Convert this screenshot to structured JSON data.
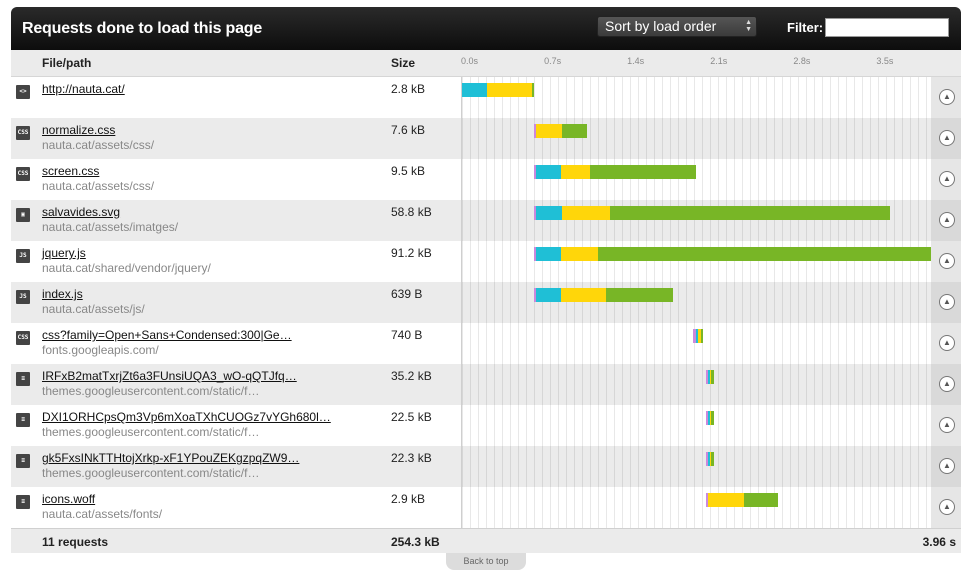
{
  "header": {
    "title": "Requests done to load this page",
    "sort_label": "Sort by load order",
    "filter_label": "Filter:",
    "filter_value": ""
  },
  "columns": {
    "file": "File/path",
    "size": "Size",
    "ticks": [
      "0.0s",
      "0.7s",
      "1.4s",
      "2.1s",
      "2.8s",
      "3.5s"
    ]
  },
  "timeline_total_seconds": 3.96,
  "requests": [
    {
      "name": "http://nauta.cat/",
      "path": "",
      "size": "2.8 kB",
      "type": "html",
      "phases": [
        {
          "k": "dns",
          "s": 0.0,
          "d": 0.21
        },
        {
          "k": "wait",
          "s": 0.21,
          "d": 0.38
        },
        {
          "k": "recv",
          "s": 0.59,
          "d": 0.02
        }
      ]
    },
    {
      "name": "normalize.css",
      "path": "nauta.cat/assets/css/",
      "size": "7.6 kB",
      "type": "css",
      "phases": [
        {
          "k": "blocked",
          "s": 0.61,
          "d": 0.01
        },
        {
          "k": "wait",
          "s": 0.62,
          "d": 0.22
        },
        {
          "k": "recv",
          "s": 0.84,
          "d": 0.21
        }
      ]
    },
    {
      "name": "screen.css",
      "path": "nauta.cat/assets/css/",
      "size": "9.5 kB",
      "type": "css",
      "phases": [
        {
          "k": "blocked",
          "s": 0.61,
          "d": 0.01
        },
        {
          "k": "dns",
          "s": 0.62,
          "d": 0.21
        },
        {
          "k": "wait",
          "s": 0.83,
          "d": 0.25
        },
        {
          "k": "recv",
          "s": 1.08,
          "d": 0.89
        }
      ]
    },
    {
      "name": "salvavides.svg",
      "path": "nauta.cat/assets/imatges/",
      "size": "58.8 kB",
      "type": "img",
      "phases": [
        {
          "k": "blocked",
          "s": 0.61,
          "d": 0.01
        },
        {
          "k": "dns",
          "s": 0.62,
          "d": 0.22
        },
        {
          "k": "wait",
          "s": 0.84,
          "d": 0.41
        },
        {
          "k": "recv",
          "s": 1.25,
          "d": 2.36
        }
      ]
    },
    {
      "name": "jquery.js",
      "path": "nauta.cat/shared/vendor/jquery/",
      "size": "91.2 kB",
      "type": "js",
      "phases": [
        {
          "k": "blocked",
          "s": 0.61,
          "d": 0.01
        },
        {
          "k": "dns",
          "s": 0.62,
          "d": 0.21
        },
        {
          "k": "wait",
          "s": 0.83,
          "d": 0.32
        },
        {
          "k": "recv",
          "s": 1.15,
          "d": 2.81
        }
      ]
    },
    {
      "name": "index.js",
      "path": "nauta.cat/assets/js/",
      "size": "639 B",
      "type": "js",
      "phases": [
        {
          "k": "blocked",
          "s": 0.61,
          "d": 0.01
        },
        {
          "k": "dns",
          "s": 0.62,
          "d": 0.21
        },
        {
          "k": "wait",
          "s": 0.83,
          "d": 0.38
        },
        {
          "k": "recv",
          "s": 1.21,
          "d": 0.57
        }
      ]
    },
    {
      "name": "css?family=Open+Sans+Condensed:300|Ge…",
      "path": "fonts.googleapis.com/",
      "size": "740 B",
      "type": "css",
      "phases": [
        {
          "k": "blocked",
          "s": 1.95,
          "d": 0.02
        },
        {
          "k": "dns",
          "s": 1.97,
          "d": 0.02
        },
        {
          "k": "wait",
          "s": 1.99,
          "d": 0.02
        },
        {
          "k": "recv",
          "s": 2.01,
          "d": 0.02
        }
      ]
    },
    {
      "name": "IRFxB2matTxrjZt6a3FUnsiUQA3_wO-qQTJfq…",
      "path": "themes.googleusercontent.com/static/f…",
      "size": "35.2 kB",
      "type": "doc",
      "phases": [
        {
          "k": "blocked",
          "s": 2.06,
          "d": 0.01
        },
        {
          "k": "dns",
          "s": 2.07,
          "d": 0.02
        },
        {
          "k": "wait",
          "s": 2.09,
          "d": 0.01
        },
        {
          "k": "recv",
          "s": 2.1,
          "d": 0.02
        }
      ]
    },
    {
      "name": "DXI1ORHCpsQm3Vp6mXoaTXhCUOGz7vYGh680l…",
      "path": "themes.googleusercontent.com/static/f…",
      "size": "22.5 kB",
      "type": "doc",
      "phases": [
        {
          "k": "blocked",
          "s": 2.06,
          "d": 0.01
        },
        {
          "k": "dns",
          "s": 2.07,
          "d": 0.02
        },
        {
          "k": "wait",
          "s": 2.09,
          "d": 0.01
        },
        {
          "k": "recv",
          "s": 2.1,
          "d": 0.02
        }
      ]
    },
    {
      "name": "gk5FxsINkTTHtojXrkp-xF1YPouZEKgzpqZW9…",
      "path": "themes.googleusercontent.com/static/f…",
      "size": "22.3 kB",
      "type": "doc",
      "phases": [
        {
          "k": "blocked",
          "s": 2.06,
          "d": 0.01
        },
        {
          "k": "dns",
          "s": 2.07,
          "d": 0.02
        },
        {
          "k": "wait",
          "s": 2.09,
          "d": 0.01
        },
        {
          "k": "recv",
          "s": 2.1,
          "d": 0.02
        }
      ]
    },
    {
      "name": "icons.woff",
      "path": "nauta.cat/assets/fonts/",
      "size": "2.9 kB",
      "type": "doc",
      "phases": [
        {
          "k": "blocked",
          "s": 2.06,
          "d": 0.01
        },
        {
          "k": "wait",
          "s": 2.07,
          "d": 0.31
        },
        {
          "k": "recv",
          "s": 2.38,
          "d": 0.28
        }
      ]
    }
  ],
  "type_labels": {
    "html": "<>",
    "css": "CSS",
    "js": "JS",
    "img": "▣",
    "doc": "≡"
  },
  "footer": {
    "count": "11 requests",
    "size": "254.3 kB",
    "time": "3.96 s"
  },
  "back_to_top": "Back to top",
  "expander_icon": "chevron-up-icon"
}
